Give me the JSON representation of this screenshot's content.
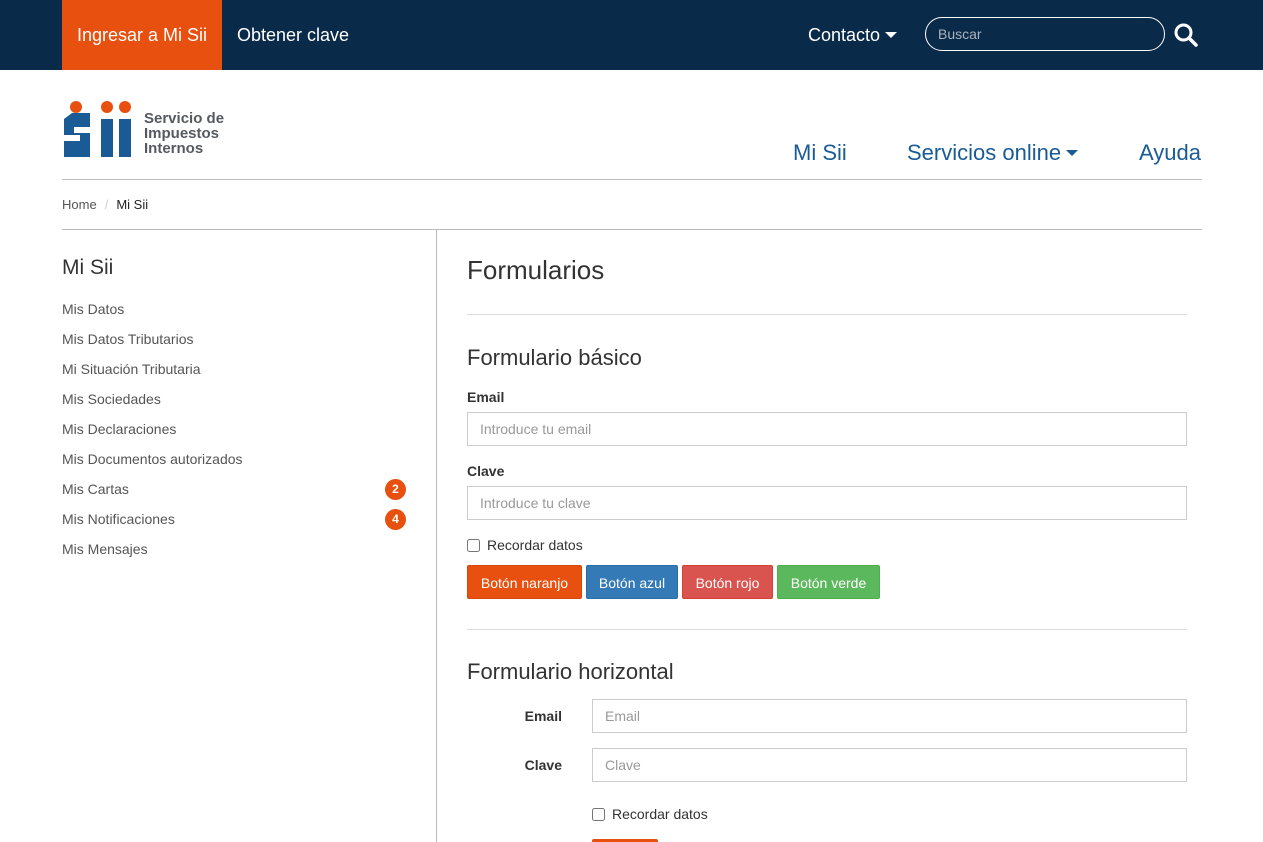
{
  "topbar": {
    "login_label": "Ingresar a Mi Sii",
    "obtain_key_label": "Obtener clave",
    "contact_label": "Contacto",
    "search_placeholder": "Buscar"
  },
  "logo": {
    "line1": "Servicio de",
    "line2": "Impuestos",
    "line3": "Internos"
  },
  "main_nav": {
    "mi_sii": "Mi Sii",
    "servicios": "Servicios online",
    "ayuda": "Ayuda"
  },
  "breadcrumb": {
    "home": "Home",
    "separator": "/",
    "current": "Mi Sii"
  },
  "sidebar": {
    "title": "Mi Sii",
    "items": [
      {
        "label": "Mis Datos"
      },
      {
        "label": "Mis Datos Tributarios"
      },
      {
        "label": "Mi Situación Tributaria"
      },
      {
        "label": "Mis Sociedades"
      },
      {
        "label": "Mis Declaraciones"
      },
      {
        "label": "Mis Documentos autorizados"
      },
      {
        "label": "Mis Cartas",
        "badge": "2"
      },
      {
        "label": "Mis Notificaciones",
        "badge": "4"
      },
      {
        "label": "Mis Mensajes"
      }
    ]
  },
  "main": {
    "page_title": "Formularios",
    "basic_form": {
      "title": "Formulario básico",
      "email_label": "Email",
      "email_placeholder": "Introduce tu email",
      "password_label": "Clave",
      "password_placeholder": "Introduce tu clave",
      "remember_label": "Recordar datos",
      "buttons": {
        "orange": "Botón naranjo",
        "blue": "Botón azul",
        "red": "Botón rojo",
        "green": "Botón verde"
      }
    },
    "horizontal_form": {
      "title": "Formulario horizontal",
      "email_label": "Email",
      "email_placeholder": "Email",
      "password_label": "Clave",
      "password_placeholder": "Clave",
      "remember_label": "Recordar datos"
    }
  },
  "colors": {
    "topbar_bg": "#0a2a49",
    "accent_orange": "#e8500f",
    "nav_blue": "#1a5b96",
    "btn_blue": "#337ab7",
    "btn_red": "#d9534f",
    "btn_green": "#5cb85c"
  }
}
